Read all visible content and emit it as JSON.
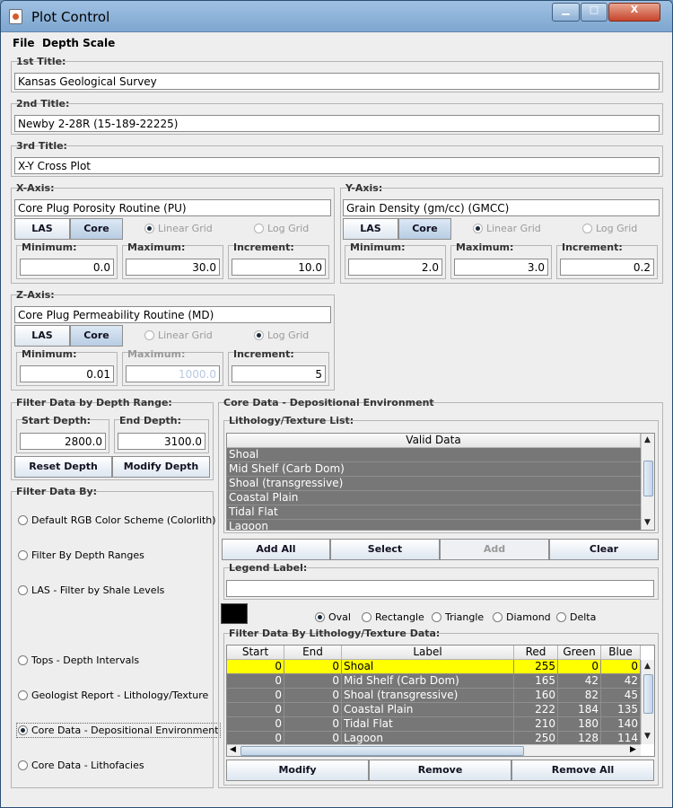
{
  "window": {
    "title": "Plot Control",
    "minimize": "▁",
    "maximize": "□",
    "close": "X"
  },
  "menu": {
    "file": "File",
    "depth_scale": "Depth Scale"
  },
  "titles": {
    "first_label": "1st Title:",
    "first_value": "Kansas Geological Survey",
    "second_label": "2nd Title:",
    "second_value": "Newby 2-28R (15-189-22225)",
    "third_label": "3rd Title:",
    "third_value": "X-Y Cross Plot"
  },
  "xaxis": {
    "legend": "X-Axis:",
    "name": "Core Plug Porosity Routine (PU)",
    "las": "LAS",
    "core": "Core",
    "linear": "Linear Grid",
    "log": "Log Grid",
    "min_label": "Minimum:",
    "min": "0.0",
    "max_label": "Maximum:",
    "max": "30.0",
    "inc_label": "Increment:",
    "inc": "10.0"
  },
  "yaxis": {
    "legend": "Y-Axis:",
    "name": "Grain Density (gm/cc) (GMCC)",
    "las": "LAS",
    "core": "Core",
    "linear": "Linear Grid",
    "log": "Log Grid",
    "min_label": "Minimum:",
    "min": "2.0",
    "max_label": "Maximum:",
    "max": "3.0",
    "inc_label": "Increment:",
    "inc": "0.2"
  },
  "zaxis": {
    "legend": "Z-Axis:",
    "name": "Core Plug Permeability Routine (MD)",
    "las": "LAS",
    "core": "Core",
    "linear": "Linear Grid",
    "log": "Log Grid",
    "min_label": "Minimum:",
    "min": "0.01",
    "max_label": "Maximum:",
    "max": "1000.0",
    "inc_label": "Increment:",
    "inc": "5"
  },
  "depth": {
    "legend": "Filter Data by Depth Range:",
    "start_label": "Start Depth:",
    "start": "2800.0",
    "end_label": "End Depth:",
    "end": "3100.0",
    "reset": "Reset Depth",
    "modify": "Modify Depth"
  },
  "filter": {
    "legend": "Filter Data By:",
    "options": [
      "Default RGB Color Scheme (Colorlith)",
      "Filter By Depth Ranges",
      "LAS - Filter by Shale Levels",
      "Tops - Depth Intervals",
      "Geologist Report - Lithology/Texture",
      "Core Data - Depositional Environment",
      "Core Data - Lithofacies"
    ],
    "selected": "Core Data - Depositional Environment"
  },
  "core": {
    "legend": "Core Data - Depositional Environment",
    "list_legend": "Lithology/Texture List:",
    "list_header": "Valid Data",
    "list_items": [
      "Shoal",
      "Mid Shelf (Carb Dom)",
      "Shoal (transgressive)",
      "Coastal Plain",
      "Tidal Flat",
      "Lagoon"
    ],
    "add_all": "Add All",
    "select": "Select",
    "add": "Add",
    "clear": "Clear",
    "legend_label": "Legend Label:",
    "legend_value": "",
    "swatch_color": "#000000",
    "shapes": [
      "Oval",
      "Rectangle",
      "Triangle",
      "Diamond",
      "Delta"
    ],
    "shape_selected": "Oval",
    "table_legend": "Filter Data By Lithology/Texture Data:",
    "columns": [
      "Start",
      "End",
      "Label",
      "Red",
      "Green",
      "Blue"
    ],
    "rows": [
      [
        "0",
        "0",
        "Shoal",
        "255",
        "0",
        "0"
      ],
      [
        "0",
        "0",
        "Mid Shelf (Carb Dom)",
        "165",
        "42",
        "42"
      ],
      [
        "0",
        "0",
        "Shoal (transgressive)",
        "160",
        "82",
        "45"
      ],
      [
        "0",
        "0",
        "Coastal Plain",
        "222",
        "184",
        "135"
      ],
      [
        "0",
        "0",
        "Tidal Flat",
        "210",
        "180",
        "140"
      ],
      [
        "0",
        "0",
        "Lagoon",
        "250",
        "128",
        "114"
      ]
    ],
    "highlight_color": "#ffff00",
    "modify": "Modify",
    "remove": "Remove",
    "remove_all": "Remove All"
  }
}
